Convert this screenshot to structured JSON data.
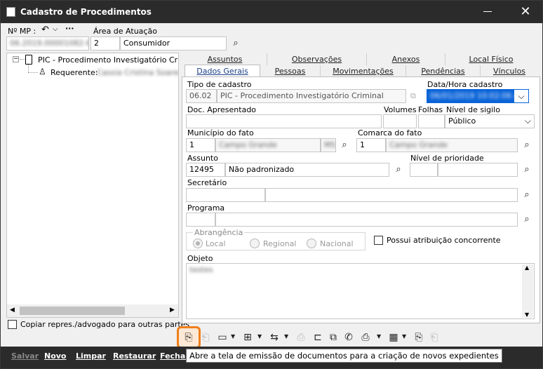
{
  "window": {
    "title": "Cadastro de Procedimentos",
    "close_glyph": "✕"
  },
  "header": {
    "mp_label": "Nº MP :",
    "mp_value": "06.2019.00001082-8",
    "area_label": "Área de Atuação",
    "area_code": "2",
    "area_name": "Consumidor"
  },
  "tree": {
    "root": "PIC - Procedimento Investigatório Crimi",
    "child_label": "Requerente:",
    "child_value": "Cassia Cristina Soares"
  },
  "copy_checkbox_label": "Copiar repres./advogado para outras partes",
  "tabs_row1": [
    "Assuntos",
    "Observações",
    "Anexos",
    "Local Físico"
  ],
  "tabs_row2": [
    "Dados Gerais",
    "Pessoas",
    "Movimentações",
    "Pendências",
    "Vínculos"
  ],
  "form": {
    "tipo_label": "Tipo de cadastro",
    "tipo_code": "06.02",
    "tipo_name": "PIC - Procedimento Investigatório Criminal",
    "datahora_label": "Data/Hora cadastro",
    "datahora_value": "06/01/2019 10:02:06 AM",
    "doc_label": "Doc. Apresentado",
    "volumes_label": "Volumes",
    "folhas_label": "Folhas",
    "sigilo_label": "Nível de sigilo",
    "sigilo_value": "Público",
    "municipio_label": "Município do fato",
    "municipio_code": "1",
    "municipio_name": "Campo Grande",
    "municipio_uf": "MS",
    "comarca_label": "Comarca do fato",
    "comarca_code": "1",
    "comarca_name": "Campo Grande",
    "assunto_label": "Assunto",
    "assunto_code": "12495",
    "assunto_name": "Não padronizado",
    "prioridade_label": "Nível de prioridade",
    "secretario_label": "Secretário",
    "programa_label": "Programa",
    "abrangencia_label": "Abrangência",
    "abrangencia_options": [
      "Local",
      "Regional",
      "Nacional"
    ],
    "concorrente_label": "Possui atribuição concorrente",
    "objeto_label": "Objeto",
    "objeto_value": "testes"
  },
  "footer_buttons": [
    "Salvar",
    "Novo",
    "Limpar",
    "Restaurar",
    "Fechar"
  ],
  "tooltip": "Abre a tela de emissão de documentos para a criação de novos expedientes",
  "colors": {
    "titlebar": "#2b2b2b",
    "highlight": "#f07f1a",
    "accent_tab": "#1a3f8a",
    "selection": "#0a64d8"
  }
}
